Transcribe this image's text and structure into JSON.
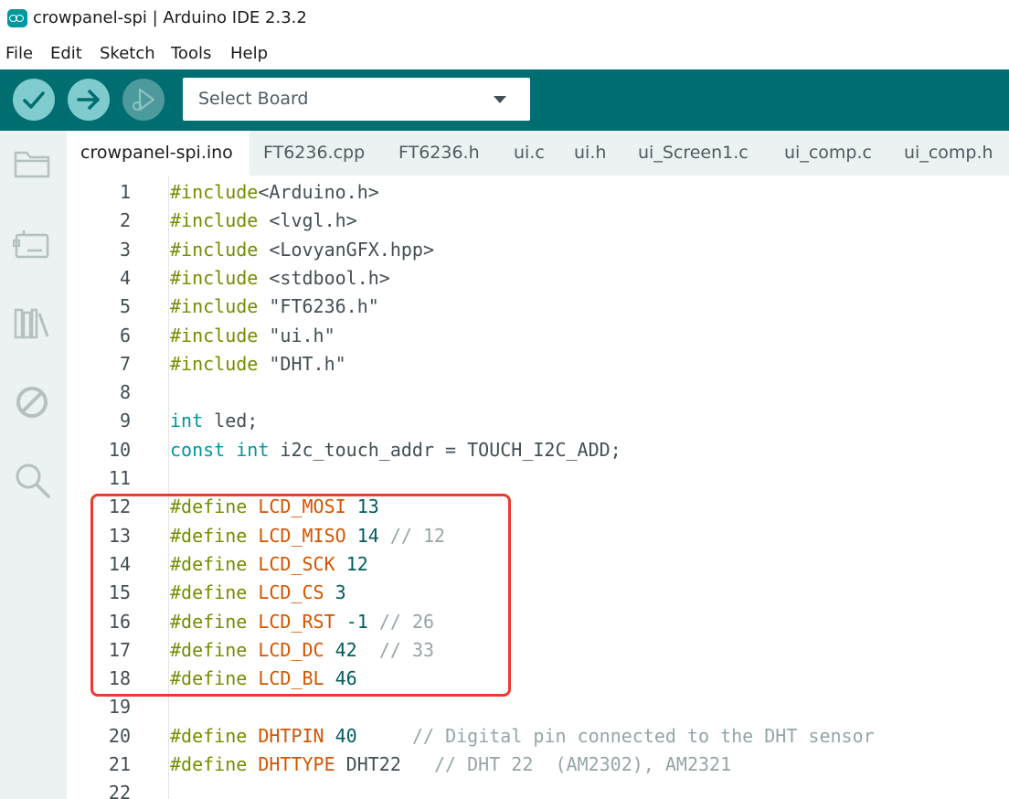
{
  "window": {
    "title": "crowpanel-spi | Arduino IDE 2.3.2",
    "icon": "arduino-logo-icon"
  },
  "menu": [
    "File",
    "Edit",
    "Sketch",
    "Tools",
    "Help"
  ],
  "toolbar": {
    "verify_icon": "check-icon",
    "upload_icon": "arrow-right-icon",
    "debug_icon": "debug-play-icon",
    "board_select": "Select Board"
  },
  "sidebar": [
    "folder-icon",
    "board-manager-icon",
    "library-icon",
    "no-debug-icon",
    "search-icon"
  ],
  "tabs": [
    "crowpanel-spi.ino",
    "FT6236.cpp",
    "FT6236.h",
    "ui.c",
    "ui.h",
    "ui_Screen1.c",
    "ui_comp.c",
    "ui_comp.h"
  ],
  "code": [
    {
      "n": "1",
      "t": [
        [
          "inc",
          "#include"
        ],
        [
          "plain",
          "<Arduino.h>"
        ]
      ]
    },
    {
      "n": "2",
      "t": [
        [
          "inc",
          "#include"
        ],
        [
          "plain",
          " <lvgl.h>"
        ]
      ]
    },
    {
      "n": "3",
      "t": [
        [
          "inc",
          "#include"
        ],
        [
          "plain",
          " <LovyanGFX.hpp>"
        ]
      ]
    },
    {
      "n": "4",
      "t": [
        [
          "inc",
          "#include"
        ],
        [
          "plain",
          " <stdbool.h>"
        ]
      ]
    },
    {
      "n": "5",
      "t": [
        [
          "inc",
          "#include"
        ],
        [
          "plain",
          " \"FT6236.h\""
        ]
      ]
    },
    {
      "n": "6",
      "t": [
        [
          "inc",
          "#include"
        ],
        [
          "plain",
          " \"ui.h\""
        ]
      ]
    },
    {
      "n": "7",
      "t": [
        [
          "inc",
          "#include"
        ],
        [
          "plain",
          " \"DHT.h\""
        ]
      ]
    },
    {
      "n": "8",
      "t": []
    },
    {
      "n": "9",
      "t": [
        [
          "type",
          "int"
        ],
        [
          "plain",
          " led;"
        ]
      ]
    },
    {
      "n": "10",
      "t": [
        [
          "type",
          "const"
        ],
        [
          "plain",
          " "
        ],
        [
          "type",
          "int"
        ],
        [
          "plain",
          " i2c_touch_addr = TOUCH_I2C_ADD;"
        ]
      ]
    },
    {
      "n": "11",
      "t": []
    },
    {
      "n": "12",
      "t": [
        [
          "inc",
          "#define"
        ],
        [
          "plain",
          " "
        ],
        [
          "const",
          "LCD_MOSI"
        ],
        [
          "plain",
          " "
        ],
        [
          "num",
          "13"
        ]
      ]
    },
    {
      "n": "13",
      "t": [
        [
          "inc",
          "#define"
        ],
        [
          "plain",
          " "
        ],
        [
          "const",
          "LCD_MISO"
        ],
        [
          "plain",
          " "
        ],
        [
          "num",
          "14"
        ],
        [
          "plain",
          " "
        ],
        [
          "com",
          "// 12"
        ]
      ]
    },
    {
      "n": "14",
      "t": [
        [
          "inc",
          "#define"
        ],
        [
          "plain",
          " "
        ],
        [
          "const",
          "LCD_SCK"
        ],
        [
          "plain",
          " "
        ],
        [
          "num",
          "12"
        ]
      ]
    },
    {
      "n": "15",
      "t": [
        [
          "inc",
          "#define"
        ],
        [
          "plain",
          " "
        ],
        [
          "const",
          "LCD_CS"
        ],
        [
          "plain",
          " "
        ],
        [
          "num",
          "3"
        ]
      ]
    },
    {
      "n": "16",
      "t": [
        [
          "inc",
          "#define"
        ],
        [
          "plain",
          " "
        ],
        [
          "const",
          "LCD_RST"
        ],
        [
          "plain",
          " "
        ],
        [
          "num",
          "-1"
        ],
        [
          "plain",
          " "
        ],
        [
          "com",
          "// 26"
        ]
      ]
    },
    {
      "n": "17",
      "t": [
        [
          "inc",
          "#define"
        ],
        [
          "plain",
          " "
        ],
        [
          "const",
          "LCD_DC"
        ],
        [
          "plain",
          " "
        ],
        [
          "num",
          "42"
        ],
        [
          "plain",
          "  "
        ],
        [
          "com",
          "// 33"
        ]
      ]
    },
    {
      "n": "18",
      "t": [
        [
          "inc",
          "#define"
        ],
        [
          "plain",
          " "
        ],
        [
          "const",
          "LCD_BL"
        ],
        [
          "plain",
          " "
        ],
        [
          "num",
          "46"
        ]
      ]
    },
    {
      "n": "19",
      "t": []
    },
    {
      "n": "20",
      "t": [
        [
          "inc",
          "#define"
        ],
        [
          "plain",
          " "
        ],
        [
          "const",
          "DHTPIN"
        ],
        [
          "plain",
          " "
        ],
        [
          "num",
          "40"
        ],
        [
          "plain",
          "     "
        ],
        [
          "com",
          "// Digital pin connected to the DHT sensor"
        ]
      ]
    },
    {
      "n": "21",
      "t": [
        [
          "inc",
          "#define"
        ],
        [
          "plain",
          " "
        ],
        [
          "const",
          "DHTTYPE"
        ],
        [
          "plain",
          " DHT22   "
        ],
        [
          "com",
          "// DHT 22  (AM2302), AM2321"
        ]
      ]
    },
    {
      "n": "22",
      "t": []
    }
  ],
  "colors": {
    "toolbar": "#006d70",
    "highlight": "#ea3b2e"
  }
}
